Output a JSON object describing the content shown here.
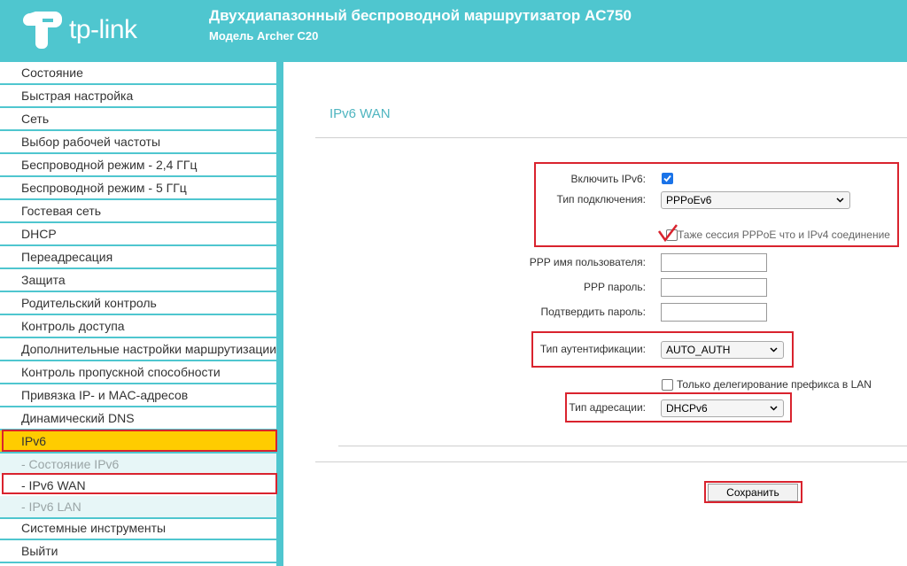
{
  "header": {
    "brand": "tp-link",
    "title": "Двухдиапазонный беспроводной маршрутизатор AC750",
    "subtitle": "Модель Archer C20"
  },
  "sidebar": {
    "items": [
      {
        "label": "Состояние"
      },
      {
        "label": "Быстрая настройка"
      },
      {
        "label": "Сеть"
      },
      {
        "label": "Выбор рабочей частоты"
      },
      {
        "label": "Беспроводной режим - 2,4 ГГц"
      },
      {
        "label": "Беспроводной режим - 5 ГГц"
      },
      {
        "label": "Гостевая сеть"
      },
      {
        "label": "DHCP"
      },
      {
        "label": "Переадресация"
      },
      {
        "label": "Защита"
      },
      {
        "label": "Родительский контроль"
      },
      {
        "label": "Контроль доступа"
      },
      {
        "label": "Дополнительные настройки маршрутизации"
      },
      {
        "label": "Контроль пропускной способности"
      },
      {
        "label": "Привязка IP- и MAC-адресов"
      },
      {
        "label": "Динамический DNS"
      },
      {
        "label": "IPv6"
      },
      {
        "label": "- Состояние IPv6"
      },
      {
        "label": "- IPv6 WAN"
      },
      {
        "label": "- IPv6 LAN"
      },
      {
        "label": "Системные инструменты"
      },
      {
        "label": "Выйти"
      }
    ]
  },
  "main": {
    "title": "IPv6 WAN",
    "enable_ipv6_label": "Включить IPv6:",
    "enable_ipv6_checked": true,
    "connection_type_label": "Тип подключения:",
    "connection_type_value": "PPPoEv6",
    "same_session_note": "Таже сессия PPPoE что и IPv4 соединение",
    "ppp_username_label": "PPP имя пользователя:",
    "ppp_password_label": "PPP пароль:",
    "confirm_password_label": "Подтвердить пароль:",
    "auth_type_label": "Тип аутентификации:",
    "auth_type_value": "AUTO_AUTH",
    "prefix_delegation_label": "Только делегирование префикса в LAN",
    "prefix_delegation_checked": false,
    "addressing_type_label": "Тип адресации:",
    "addressing_type_value": "DHCPv6",
    "save_label": "Сохранить"
  },
  "colors": {
    "brand": "#4fc6cf",
    "active_menu": "#ffcc00",
    "highlight_box": "#d9232e",
    "title_text": "#4fb5c0"
  }
}
